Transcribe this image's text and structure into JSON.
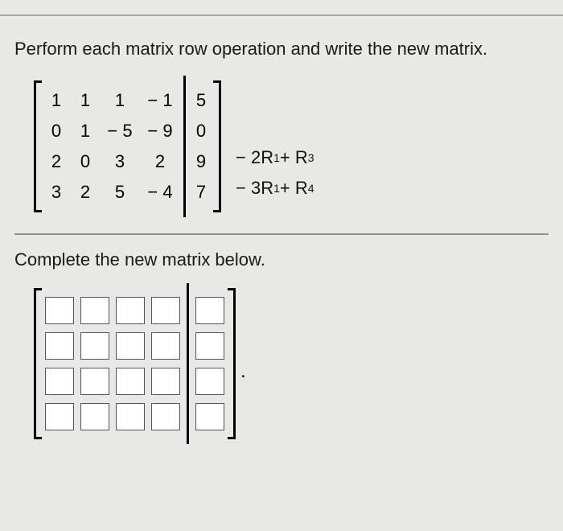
{
  "instruction": "Perform each matrix row operation and write the new matrix.",
  "matrix": {
    "rows": [
      {
        "cells": [
          "1",
          "1",
          "1",
          "− 1"
        ],
        "aug": "5"
      },
      {
        "cells": [
          "0",
          "1",
          "− 5",
          "− 9"
        ],
        "aug": "0"
      },
      {
        "cells": [
          "2",
          "0",
          "3",
          "2"
        ],
        "aug": "9"
      },
      {
        "cells": [
          "3",
          "2",
          "5",
          "− 4"
        ],
        "aug": "7"
      }
    ]
  },
  "operations": {
    "line1": {
      "prefix": "− 2R",
      "sub1": "1",
      "mid": " + R",
      "sub2": "3"
    },
    "line2": {
      "prefix": "− 3R",
      "sub1": "1",
      "mid": " + R",
      "sub2": "4"
    }
  },
  "complete_text": "Complete the new matrix below.",
  "answer_matrix": {
    "rows": 4,
    "cols": 4,
    "aug_cols": 1
  },
  "period": "."
}
